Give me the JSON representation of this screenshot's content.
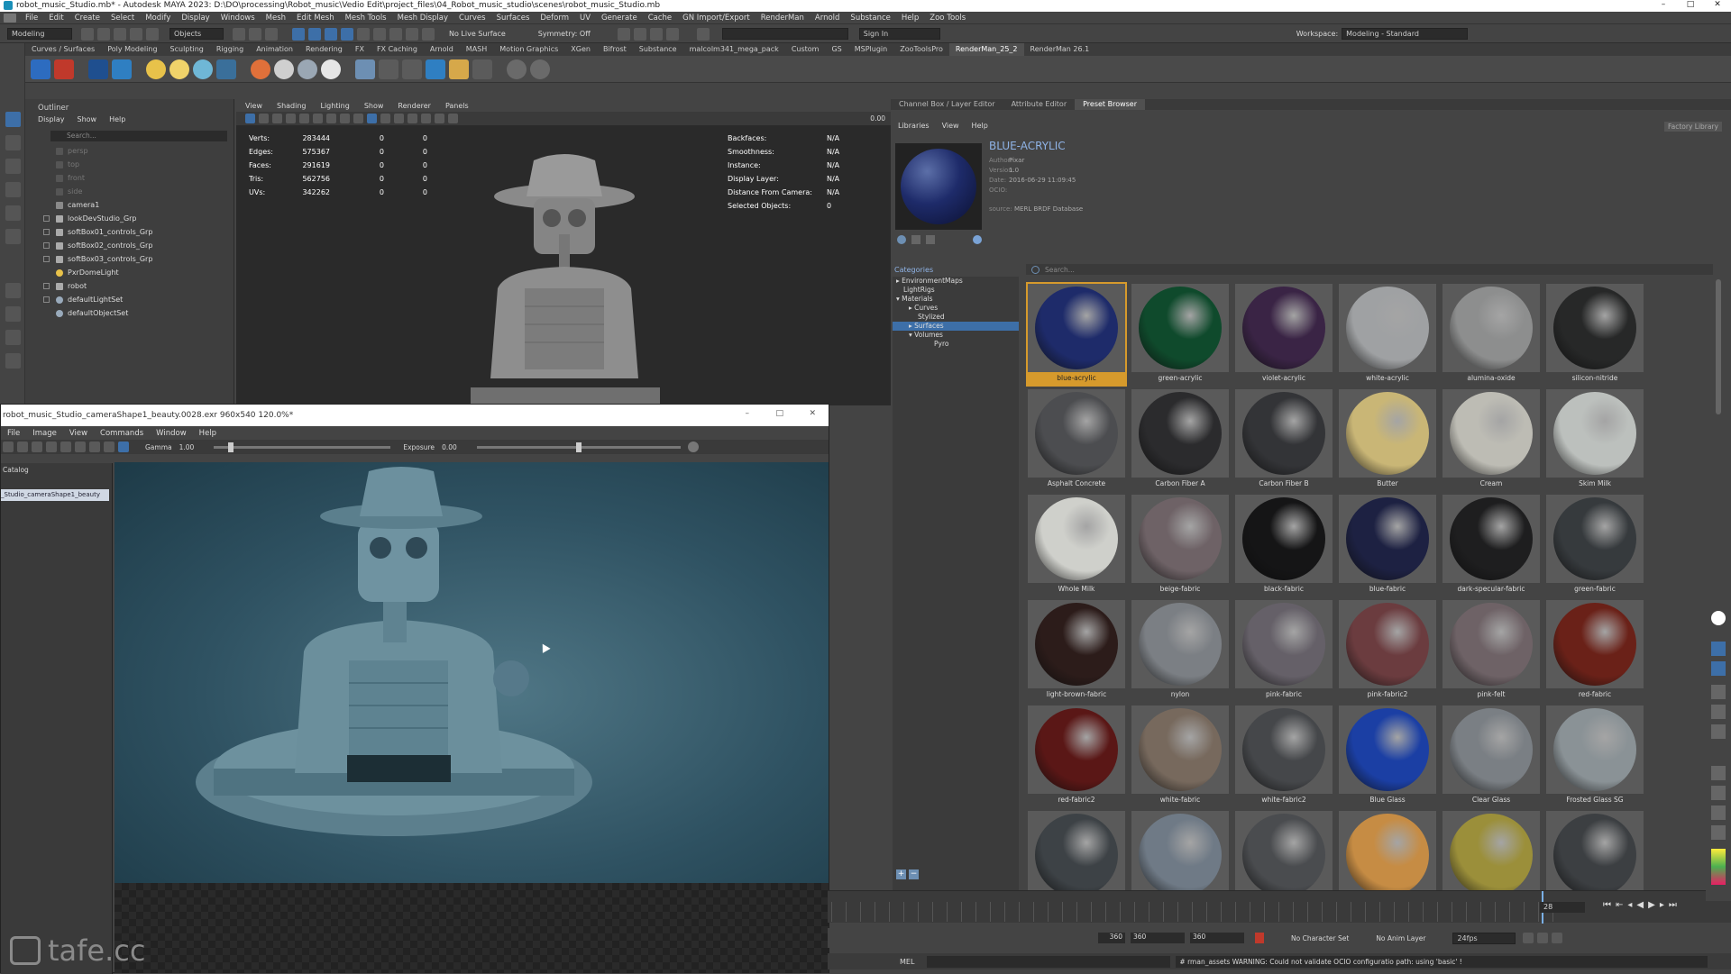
{
  "window": {
    "title": "robot_music_Studio.mb* - Autodesk MAYA 2023: D:\\DO\\processing\\Robot_music\\Vedio Edit\\project_files\\04_Robot_music_studio\\scenes\\robot_music_Studio.mb",
    "controls": [
      "–",
      "□",
      "✕"
    ]
  },
  "menubar": [
    "File",
    "Edit",
    "Create",
    "Select",
    "Modify",
    "Display",
    "Windows",
    "Mesh",
    "Edit Mesh",
    "Mesh Tools",
    "Mesh Display",
    "Curves",
    "Surfaces",
    "Deform",
    "UV",
    "Generate",
    "Cache",
    "GN Import/Export",
    "RenderMan",
    "Arnold",
    "Substance",
    "Help",
    "Zoo Tools"
  ],
  "statusline": {
    "mode": "Modeling",
    "objects": "Objects",
    "live_surface": "No Live Surface",
    "symmetry": "Symmetry: Off",
    "sign_in": "Sign In",
    "workspace_label": "Workspace:",
    "workspace": "Modeling - Standard"
  },
  "shelf_tabs": [
    "Curves / Surfaces",
    "Poly Modeling",
    "Sculpting",
    "Rigging",
    "Animation",
    "Rendering",
    "FX",
    "FX Caching",
    "Arnold",
    "MASH",
    "Motion Graphics",
    "XGen",
    "Bifrost",
    "Substance",
    "malcolm341_mega_pack",
    "Custom",
    "GS",
    "MSPlugin",
    "ZooToolsPro",
    "RenderMan_25_2",
    "RenderMan 26.1"
  ],
  "active_shelf": "RenderMan_25_2",
  "outliner": {
    "title": "Outliner",
    "menu": [
      "Display",
      "Show",
      "Help"
    ],
    "search_placeholder": "Search...",
    "items": [
      "persp",
      "top",
      "front",
      "side",
      "camera1",
      "lookDevStudio_Grp",
      "softBox01_controls_Grp",
      "softBox02_controls_Grp",
      "softBox03_controls_Grp",
      "PxrDomeLight",
      "robot",
      "defaultLightSet",
      "defaultObjectSet"
    ]
  },
  "viewport": {
    "menu": [
      "View",
      "Shading",
      "Lighting",
      "Show",
      "Renderer",
      "Panels"
    ],
    "stats": [
      {
        "label": "Verts:",
        "v1": "283444",
        "v2": "0",
        "v3": "0"
      },
      {
        "label": "Edges:",
        "v1": "575367",
        "v2": "0",
        "v3": "0"
      },
      {
        "label": "Faces:",
        "v1": "291619",
        "v2": "0",
        "v3": "0"
      },
      {
        "label": "Tris:",
        "v1": "562756",
        "v2": "0",
        "v3": "0"
      },
      {
        "label": "UVs:",
        "v1": "342262",
        "v2": "0",
        "v3": "0"
      }
    ],
    "stats_right": [
      {
        "label": "Backfaces:",
        "value": "N/A"
      },
      {
        "label": "Smoothness:",
        "value": "N/A"
      },
      {
        "label": "Instance:",
        "value": "N/A"
      },
      {
        "label": "Display Layer:",
        "value": "N/A"
      },
      {
        "label": "Distance From Camera:",
        "value": "N/A"
      },
      {
        "label": "Selected Objects:",
        "value": "0"
      }
    ],
    "exposure": "0.00"
  },
  "render_view": {
    "title": "robot_music_Studio_cameraShape1_beauty.0028.exr  960x540  120.0%*",
    "menu": [
      "File",
      "Image",
      "View",
      "Commands",
      "Window",
      "Help"
    ],
    "gamma_label": "Gamma",
    "gamma_value": "1.00",
    "exposure_label": "Exposure",
    "exposure_value": "0.00",
    "catalog_label": "Catalog",
    "catalog_item": "_Studio_cameraShape1_beauty",
    "watermark": "tafe.cc"
  },
  "right_panel": {
    "tabs": [
      "Channel Box / Layer Editor",
      "Attribute Editor",
      "Preset Browser"
    ],
    "active_tab": "Preset Browser",
    "menu": [
      "Libraries",
      "View",
      "Help"
    ],
    "factory_library": "Factory Library",
    "preset": {
      "name": "BLUE-ACRYLIC",
      "author_label": "Author:",
      "author": "Pixar",
      "version_label": "Version:",
      "version": "1.0",
      "date_label": "Date:",
      "date": "2016-06-29 11:09:45",
      "ocio_label": "OCIO:",
      "source_label": "source:",
      "source": "MERL BRDF Database"
    },
    "categories_title": "Categories",
    "categories": [
      {
        "label": "EnvironmentMaps",
        "indent": 0
      },
      {
        "label": "LightRigs",
        "indent": 0
      },
      {
        "label": "Materials",
        "indent": 0
      },
      {
        "label": "Curves",
        "indent": 1
      },
      {
        "label": "Stylized",
        "indent": 1
      },
      {
        "label": "Surfaces",
        "indent": 1,
        "selected": true
      },
      {
        "label": "Volumes",
        "indent": 1
      },
      {
        "label": "Pyro",
        "indent": 2
      }
    ],
    "search_placeholder": "Search...",
    "materials": [
      {
        "name": "blue-acrylic",
        "color": "#1e2b6a"
      },
      {
        "name": "green-acrylic",
        "color": "#0f4a2c"
      },
      {
        "name": "violet-acrylic",
        "color": "#3a2445"
      },
      {
        "name": "white-acrylic",
        "color": "#9fa1a3"
      },
      {
        "name": "alumina-oxide",
        "color": "#8d8e8e"
      },
      {
        "name": "silicon-nitride",
        "color": "#272828"
      },
      {
        "name": "Asphalt Concrete",
        "color": "#4c4d50"
      },
      {
        "name": "Carbon Fiber A",
        "color": "#2b2b2d"
      },
      {
        "name": "Carbon Fiber B",
        "color": "#333437"
      },
      {
        "name": "Butter",
        "color": "#c9b676"
      },
      {
        "name": "Cream",
        "color": "#bdbcb4"
      },
      {
        "name": "Skim Milk",
        "color": "#bcc0bd"
      },
      {
        "name": "Whole Milk",
        "color": "#cfd0cb"
      },
      {
        "name": "beige-fabric",
        "color": "#6e6266"
      },
      {
        "name": "black-fabric",
        "color": "#151516"
      },
      {
        "name": "blue-fabric",
        "color": "#1d2142"
      },
      {
        "name": "dark-specular-fabric",
        "color": "#1e1e1f"
      },
      {
        "name": "green-fabric",
        "color": "#363a3d"
      },
      {
        "name": "light-brown-fabric",
        "color": "#2c1c1a"
      },
      {
        "name": "nylon",
        "color": "#7b7f84"
      },
      {
        "name": "pink-fabric",
        "color": "#656068"
      },
      {
        "name": "pink-fabric2",
        "color": "#6b3c3f"
      },
      {
        "name": "pink-felt",
        "color": "#6e6266"
      },
      {
        "name": "red-fabric",
        "color": "#6a2118"
      },
      {
        "name": "red-fabric2",
        "color": "#5a1716"
      },
      {
        "name": "white-fabric",
        "color": "#77695d"
      },
      {
        "name": "white-fabric2",
        "color": "#45474a"
      },
      {
        "name": "Blue Glass",
        "color": "#1b3fa4"
      },
      {
        "name": "Clear Glass",
        "color": "#7a7f84"
      },
      {
        "name": "Frosted Glass SG",
        "color": "#8a9296"
      },
      {
        "name": "",
        "color": "#3d4246"
      },
      {
        "name": "",
        "color": "#6f7a86"
      },
      {
        "name": "",
        "color": "#4a4c4f"
      },
      {
        "name": "",
        "color": "#c68c44"
      },
      {
        "name": "",
        "color": "#9b8f3a"
      },
      {
        "name": "",
        "color": "#3c3f42"
      }
    ]
  },
  "timeline": {
    "current_frame": "28",
    "range_start_a": "360",
    "range_start_b": "360",
    "range_end": "360",
    "character_set": "No Character Set",
    "anim_layer": "No Anim Layer",
    "fps": "24fps"
  },
  "cmdline": {
    "label": "MEL",
    "message": "# rman_assets  WARNING: Could not validate OCIO configuratio path: using 'basic' !"
  },
  "accent": "#d69a2c"
}
